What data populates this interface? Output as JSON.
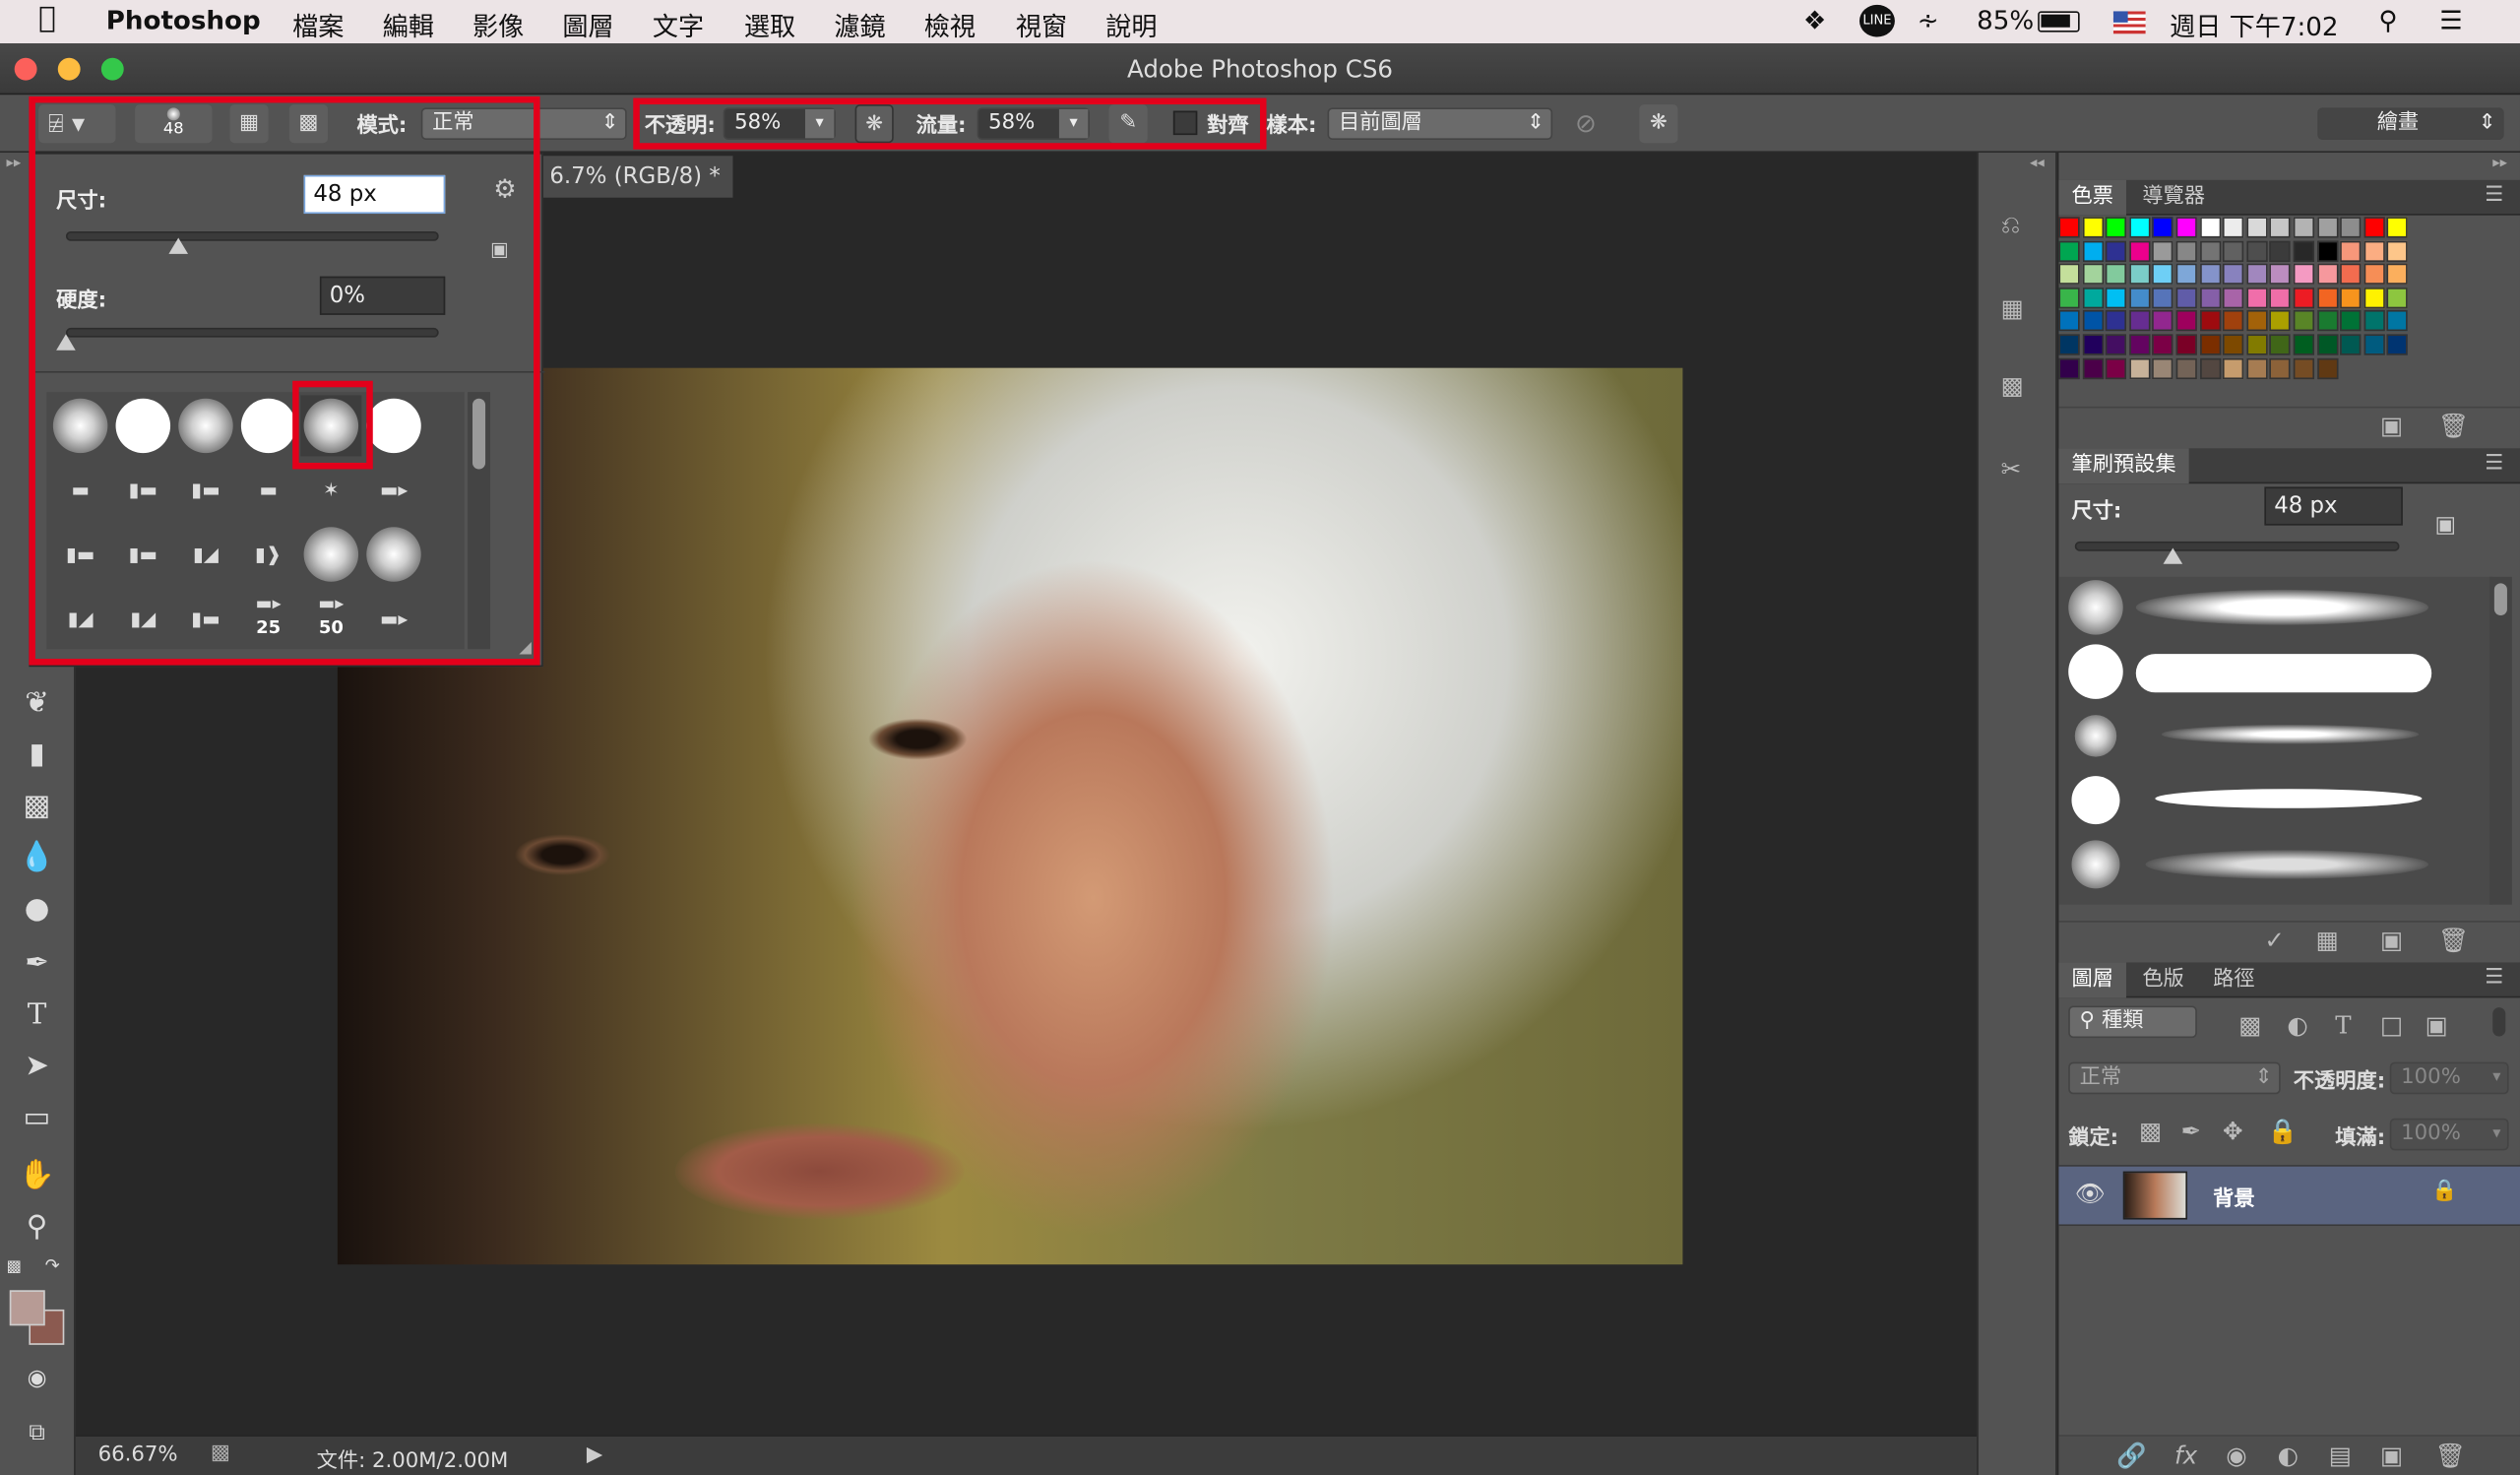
{
  "menubar": {
    "app": "Photoshop",
    "items": [
      "檔案",
      "編輯",
      "影像",
      "圖層",
      "文字",
      "選取",
      "濾鏡",
      "檢視",
      "視窗",
      "說明"
    ],
    "battery": "85%",
    "clock": "週日 下午7:02"
  },
  "window": {
    "title": "Adobe Photoshop CS6"
  },
  "options": {
    "brush_size": "48",
    "mode_label": "模式:",
    "mode_value": "正常",
    "opacity_label": "不透明:",
    "opacity_value": "58%",
    "flow_label": "流量:",
    "flow_value": "58%",
    "align_label": "對齊",
    "sample_label": "樣本:",
    "sample_value": "目前圖層",
    "workspace": "繪畫"
  },
  "brush_popup": {
    "size_label": "尺寸:",
    "size_value": "48 px",
    "hardness_label": "硬度:",
    "hardness_value": "0%",
    "size_slider": 0.3,
    "hardness_slider": 0.0,
    "brush_numbers": [
      "25",
      "50"
    ]
  },
  "document": {
    "tab": "6.7% (RGB/8) *",
    "zoom": "66.67%",
    "file_info": "文件: 2.00M/2.00M"
  },
  "swatches": {
    "tabs": [
      "色票",
      "導覽器"
    ],
    "colors": [
      [
        "#ff0000",
        "#ffff00",
        "#00ff00",
        "#00ffff",
        "#0000ff",
        "#ff00ff",
        "#ffffff",
        "#ececec",
        "#d9d9d9",
        "#c6c6c6",
        "#b3b3b3",
        "#a0a0a0",
        "#8d8d8d",
        "#ff0000",
        "#ffff00"
      ],
      [
        "#00a651",
        "#00aeef",
        "#2e3192",
        "#ec008c",
        "#9a9a9a",
        "#878787",
        "#747474",
        "#616161",
        "#4e4e4e",
        "#3b3b3b",
        "#282828",
        "#000000",
        "#f7977a",
        "#fbad82",
        "#fdc68a"
      ],
      [
        "#c4df9b",
        "#a3d39c",
        "#82ca9d",
        "#7bcdc8",
        "#6ecff6",
        "#7ea7d8",
        "#8493ca",
        "#8882be",
        "#a187be",
        "#bc8dbf",
        "#f49ac2",
        "#f6989d",
        "#f26c4f",
        "#f68e56",
        "#fbaf5d"
      ],
      [
        "#39b54a",
        "#00a99d",
        "#00bff3",
        "#448ccb",
        "#5674b9",
        "#605ca8",
        "#855fa8",
        "#a864a8",
        "#f06eaa",
        "#ef6ea8",
        "#ed1c24",
        "#f26522",
        "#f7941d",
        "#fff200",
        "#8dc63f"
      ],
      [
        "#0072bc",
        "#0054a6",
        "#2e3192",
        "#662d91",
        "#92278f",
        "#9e005d",
        "#9e0b0f",
        "#a0410d",
        "#a36209",
        "#aba000",
        "#598527",
        "#1a7b30",
        "#007236",
        "#00746b",
        "#0076a3"
      ],
      [
        "#003663",
        "#21005d",
        "#440e62",
        "#630460",
        "#7b0046",
        "#7a0026",
        "#7b2e00",
        "#7d4900",
        "#827b00",
        "#406618",
        "#005e20",
        "#005826",
        "#005952",
        "#005b7f",
        "#003471"
      ],
      [
        "#32004b",
        "#4b0049",
        "#7b0046",
        "#c7b299",
        "#998675",
        "#736357",
        "#534741",
        "#c69c6d",
        "#a67c52",
        "#8c6239",
        "#754c24",
        "#603913"
      ]
    ]
  },
  "brush_presets": {
    "title": "筆刷預設集",
    "size_label": "尺寸:",
    "size_value": "48 px"
  },
  "layers": {
    "tabs": [
      "圖層",
      "色版",
      "路徑"
    ],
    "kind": "種類",
    "blend": "正常",
    "opacity_label": "不透明度:",
    "opacity_value": "100%",
    "lock_label": "鎖定:",
    "fill_label": "填滿:",
    "fill_value": "100%",
    "layer_name": "背景"
  }
}
